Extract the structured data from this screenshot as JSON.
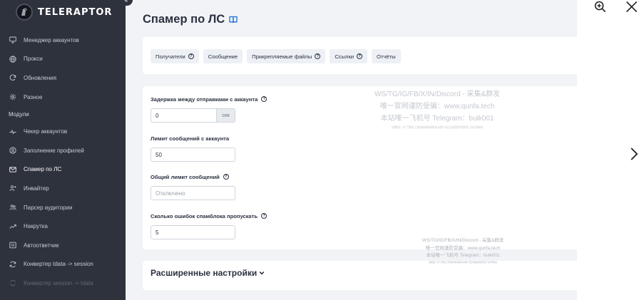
{
  "app": {
    "brand": "TELERAPTOR",
    "collapse_glyph": "«"
  },
  "sidebar": {
    "items": [
      {
        "label": "Менеджер аккаунтов",
        "icon": "monitor-icon"
      },
      {
        "label": "Прокси",
        "icon": "globe-icon"
      },
      {
        "label": "Обновления",
        "icon": "refresh-icon"
      },
      {
        "label": "Разное",
        "icon": "gear-icon"
      }
    ],
    "section_label": "Модули",
    "modules": [
      {
        "label": "Чекер аккаунтов",
        "icon": "pulse-icon"
      },
      {
        "label": "Заполнение профилей",
        "icon": "user-circle-icon"
      },
      {
        "label": "Спамер по ЛС",
        "icon": "mail-icon",
        "active": true
      },
      {
        "label": "Инвайтер",
        "icon": "user-plus-icon"
      },
      {
        "label": "Парсер аудитории",
        "icon": "users-icon"
      },
      {
        "label": "Накрутка",
        "icon": "trend-icon"
      },
      {
        "label": "Автоответчик",
        "icon": "message-icon"
      },
      {
        "label": "Конвертер tdata -> session",
        "icon": "convert-icon"
      },
      {
        "label": "Конвертер session -> tdata",
        "icon": "convert-icon"
      }
    ]
  },
  "page": {
    "title": "Спамер по ЛС",
    "title_icon": "book-icon"
  },
  "tabs": [
    {
      "label": "Получатели",
      "help": true
    },
    {
      "label": "Сообщение",
      "help": false
    },
    {
      "label": "Прикрепляемые файлы",
      "help": true
    },
    {
      "label": "Ссылки",
      "help": true
    },
    {
      "label": "Отчёты",
      "help": false
    }
  ],
  "form": {
    "delay": {
      "label": "Задержка между отправками с аккаунта",
      "value": "0",
      "unit": "сек"
    },
    "limit_per_account": {
      "label": "Лимит сообщений с аккаунта",
      "value": "50"
    },
    "total_limit": {
      "label": "Общий лимит сообщений",
      "placeholder": "Отключено"
    },
    "spamblock_errors": {
      "label": "Сколько ошибок спамблока пропускать",
      "value": "5"
    }
  },
  "advanced": {
    "title": "Расширенные настройки"
  },
  "help_glyph": "?",
  "watermark": {
    "line1": "WS/TG/IG/FB/X/IN/Discord - 采集&群发",
    "line2": "唯一官网谨防受骗：www.qunfa.tech",
    "line3": "本站唯一飞机号 Telegram：bulk001",
    "line4": "如需进一步了解社工库或接单请联系本群介绍方或提供的联系飞机号联系"
  },
  "colors": {
    "sidebar_bg": "#2e323d",
    "main_bg": "#f1f3f6",
    "accent": "#1e6fd9",
    "text": "#2c3140"
  }
}
